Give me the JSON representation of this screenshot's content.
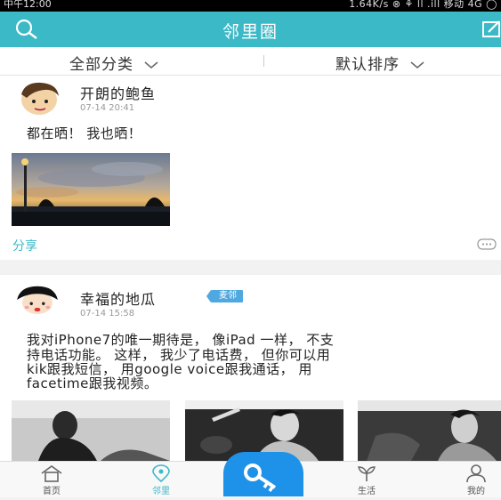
{
  "status_bar": {
    "time": "中午12:00",
    "right": "1.64K/s ⊗ ⚘ ll .ill 移动 4G ◯"
  },
  "header": {
    "title": "邻里圈"
  },
  "filters": {
    "category": "全部分类",
    "sort": "默认排序"
  },
  "posts": [
    {
      "username": "开朗的鲍鱼",
      "time": "07-14 20:41",
      "text": "都在晒！ 我也晒！",
      "share_label": "分享"
    },
    {
      "username": "幸福的地瓜",
      "badge": "麦邻",
      "time": "07-14 15:58",
      "text_lines": [
        "我对iPhone7的唯一期待是， 像iPad 一样， 不支",
        "持电话功能。 这样， 我少了电话费， 但你可以用",
        "kik跟我短信， 用google voice跟我通话， 用",
        "facetime跟我视频。"
      ]
    }
  ],
  "bottom_nav": [
    {
      "label": "首页",
      "icon": "home-icon"
    },
    {
      "label": "邻里",
      "icon": "location-pin-icon",
      "active": true
    },
    {
      "label": "生活",
      "icon": "sprout-icon"
    },
    {
      "label": "我的",
      "icon": "person-icon"
    }
  ],
  "center_button": {
    "icon": "key-icon"
  },
  "colors": {
    "accent": "#3bb9c7",
    "badge": "#4fa8e0",
    "key_button": "#1e92e8"
  }
}
